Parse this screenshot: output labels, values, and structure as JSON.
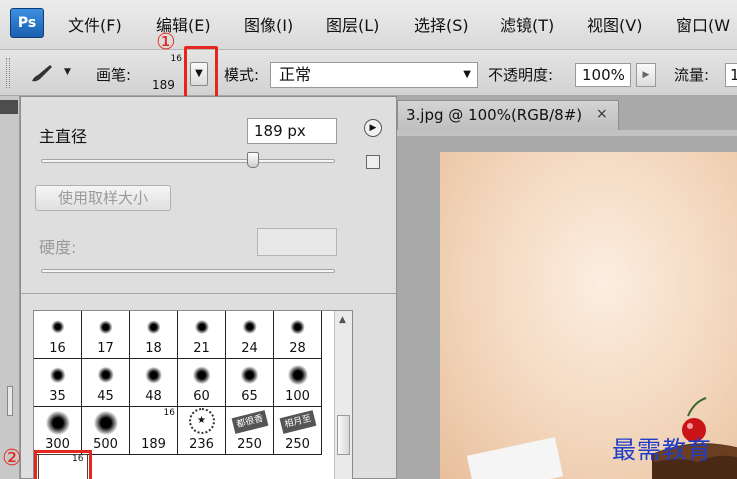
{
  "app": {
    "logo": "Ps"
  },
  "menu": [
    "文件(F)",
    "编辑(E)",
    "图像(I)",
    "图层(L)",
    "选择(S)",
    "滤镜(T)",
    "视图(V)",
    "窗口(W"
  ],
  "options_bar": {
    "brush_label": "画笔:",
    "brush_preview_top": "16",
    "brush_preview_size": "189",
    "mode_label": "模式:",
    "mode_value": "正常",
    "opacity_label": "不透明度:",
    "opacity_value": "100%",
    "flow_label": "流量:",
    "flow_value": "1"
  },
  "annotations": {
    "marker1": "①",
    "marker2": "②"
  },
  "brush_panel": {
    "diameter_label": "主直径",
    "diameter_value": "189 px",
    "diameter_fraction": 0.72,
    "sample_button": "使用取样大小",
    "hardness_label": "硬度:",
    "presets": [
      {
        "label": "16",
        "type": "dot"
      },
      {
        "label": "17",
        "type": "dot"
      },
      {
        "label": "18",
        "type": "dot"
      },
      {
        "label": "21",
        "type": "dot"
      },
      {
        "label": "24",
        "type": "dot"
      },
      {
        "label": "28",
        "type": "dot"
      },
      {
        "label": "35",
        "type": "dot"
      },
      {
        "label": "45",
        "type": "dot"
      },
      {
        "label": "48",
        "type": "dot"
      },
      {
        "label": "60",
        "type": "dot"
      },
      {
        "label": "65",
        "type": "dot"
      },
      {
        "label": "100",
        "type": "dot"
      },
      {
        "label": "300",
        "type": "dot"
      },
      {
        "label": "500",
        "type": "dot"
      },
      {
        "label": "189",
        "type": "empty",
        "mini": "16"
      },
      {
        "label": "236",
        "type": "star"
      },
      {
        "label": "250",
        "type": "stamp",
        "stamp_text": "都很香"
      },
      {
        "label": "250",
        "type": "stamp",
        "stamp_text": "相月至"
      }
    ],
    "selected_preset_mini": "16"
  },
  "document": {
    "tab_title": "3.jpg @ 100%(RGB/8#)",
    "tab_close": "×"
  },
  "watermark": "最需教育"
}
